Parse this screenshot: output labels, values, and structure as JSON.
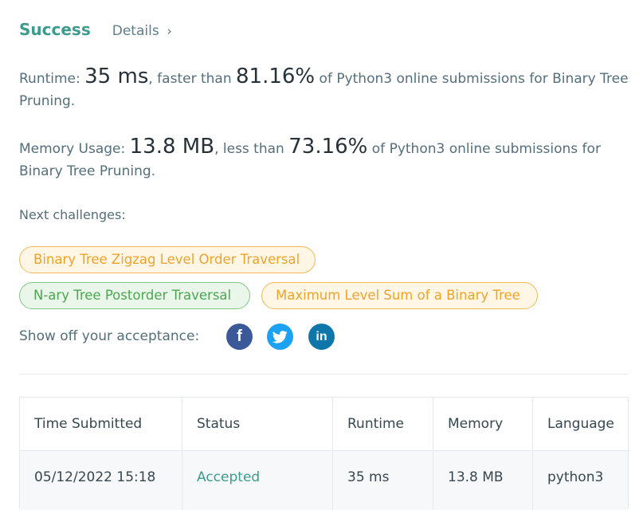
{
  "header": {
    "status": "Success",
    "details_label": "Details",
    "chevron": "›"
  },
  "runtime": {
    "prefix": "Runtime: ",
    "value": "35 ms",
    "middle": ", faster than ",
    "percent": "81.16%",
    "suffix": " of Python3 online submissions for Binary Tree Pruning."
  },
  "memory": {
    "prefix": "Memory Usage: ",
    "value": "13.8 MB",
    "middle": ", less than ",
    "percent": "73.16%",
    "suffix": " of Python3 online submissions for Binary Tree Pruning."
  },
  "next_challenges": {
    "title": "Next challenges:",
    "items": [
      {
        "label": "Binary Tree Zigzag Level Order Traversal",
        "difficulty": "medium"
      },
      {
        "label": "N-ary Tree Postorder Traversal",
        "difficulty": "easy"
      },
      {
        "label": "Maximum Level Sum of a Binary Tree",
        "difficulty": "medium"
      }
    ]
  },
  "share": {
    "label": "Show off your acceptance:",
    "icons": [
      "facebook-icon",
      "twitter-icon",
      "linkedin-icon"
    ],
    "facebook_glyph": "f",
    "linkedin_glyph": "in"
  },
  "table": {
    "headers": [
      "Time Submitted",
      "Status",
      "Runtime",
      "Memory",
      "Language"
    ],
    "rows": [
      [
        "05/12/2022 15:18",
        "Accepted",
        "35 ms",
        "13.8 MB",
        "python3"
      ]
    ]
  },
  "colors": {
    "accent": "#3d9b8e",
    "medium": "#f0a32a",
    "easy": "#4ca651"
  }
}
